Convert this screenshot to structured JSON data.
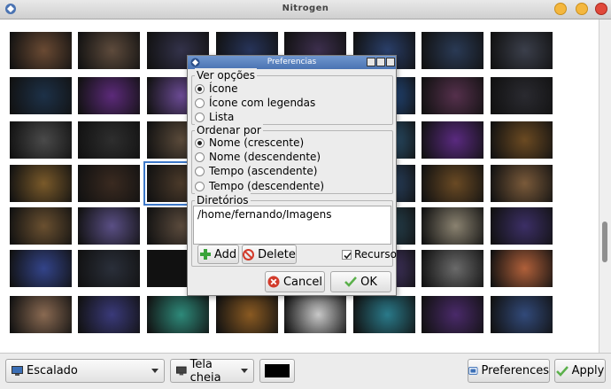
{
  "window": {
    "title": "Nitrogen"
  },
  "gallery": {
    "thumbnails": [
      {
        "c": "#6a4a33"
      },
      {
        "c": "#5e4b3c"
      },
      {
        "c": "#33324a"
      },
      {
        "c": "#27345a"
      },
      {
        "c": "#3d2f4e"
      },
      {
        "c": "#2a3f6a"
      },
      {
        "c": "#2a3a55"
      },
      {
        "c": "#3b3f4b"
      },
      {
        "c": "#1d3148"
      },
      {
        "c": "#5c2a7a"
      },
      {
        "c": "#6a4a93"
      },
      {
        "c": "#263b60"
      },
      {
        "c": "#3a3142"
      },
      {
        "c": "#26508a"
      },
      {
        "c": "#55304c"
      },
      {
        "c": "#2a2a30"
      },
      {
        "c": "#4a4a4a"
      },
      {
        "c": "#2e2e2e"
      },
      {
        "c": "#5a4a3a"
      },
      {
        "c": "#3b2a1e"
      },
      {
        "c": "#4a3058"
      },
      {
        "c": "#2e5a7a"
      },
      {
        "c": "#5a2a80"
      },
      {
        "c": "#6b4a22"
      },
      {
        "c": "#7a5a2a"
      },
      {
        "c": "#3a2a20"
      },
      {
        "c": "#4b3a2a"
      },
      {
        "c": "#443728"
      },
      {
        "c": "#3b2f22"
      },
      {
        "c": "#2d4a6d"
      },
      {
        "c": "#6a4a24"
      },
      {
        "c": "#7a5a3a"
      },
      {
        "c": "#6a5030"
      },
      {
        "c": "#5a4f85"
      },
      {
        "c": "#5a4a3c"
      },
      {
        "c": "#3a3a3a"
      },
      {
        "c": "#5a4a3a"
      },
      {
        "c": "#2a4a5a"
      },
      {
        "c": "#8a8270"
      },
      {
        "c": "#3c2f66"
      },
      {
        "c": "#33448a"
      },
      {
        "c": "#2a2f3a"
      },
      {
        "c": "#111111"
      },
      {
        "c": "#2a2e3a"
      },
      {
        "c": "#324a7a"
      },
      {
        "c": "#4a3a6e"
      },
      {
        "c": "#6a6a6a"
      },
      {
        "c": "#b0603a"
      },
      {
        "c": "#8a6a52"
      },
      {
        "c": "#3a3a7a"
      },
      {
        "c": "#2e8a7a"
      },
      {
        "c": "#8a5a22"
      },
      {
        "c": "#c8c8c8"
      },
      {
        "c": "#2a7a8a"
      },
      {
        "c": "#4a2a6a"
      },
      {
        "c": "#324a7a"
      }
    ],
    "selected_index": 26
  },
  "preferences_dialog": {
    "title": "Preferencias",
    "view_group": {
      "label": "Ver opções",
      "options": [
        {
          "label": "Ícone",
          "checked": true
        },
        {
          "label": "Ícone com legendas",
          "checked": false
        },
        {
          "label": "Lista",
          "checked": false
        }
      ]
    },
    "sort_group": {
      "label": "Ordenar por",
      "options": [
        {
          "label": "Nome (crescente)",
          "checked": true
        },
        {
          "label": "Nome (descendente)",
          "checked": false
        },
        {
          "label": "Tempo (ascendente)",
          "checked": false
        },
        {
          "label": "Tempo (descendente)",
          "checked": false
        }
      ]
    },
    "dirs_group": {
      "label": "Diretórios",
      "entries": [
        "/home/fernando/Imagens"
      ]
    },
    "add_label": "Add",
    "delete_label": "Delete",
    "recurse_label": "Recurso",
    "recurse_checked": true,
    "cancel_label": "Cancel",
    "ok_label": "OK"
  },
  "bottombar": {
    "scale_combo": "Escalado",
    "screen_combo": "Tela cheia",
    "bg_color": "#000000",
    "preferences_label": "Preferences",
    "apply_label": "Apply"
  },
  "colors": {
    "selection_border": "#3d78c8",
    "dialog_title_bg": "#4a73b2",
    "add_icon": "#3aa33a",
    "delete_icon": "#d23a2a",
    "ok_icon": "#5ab04a"
  }
}
